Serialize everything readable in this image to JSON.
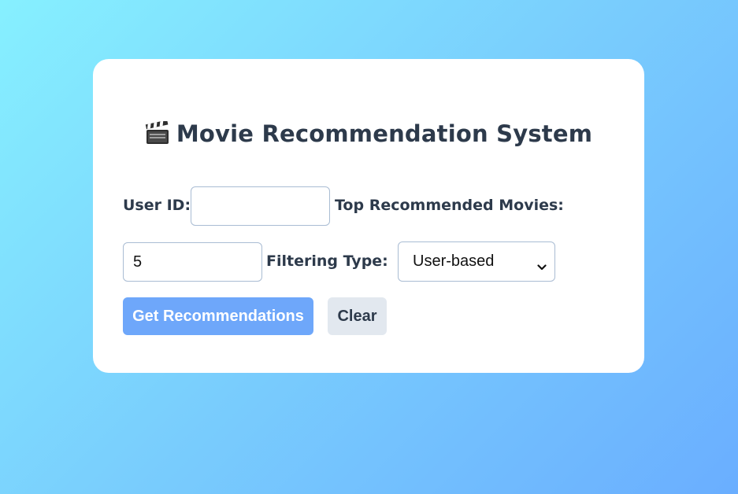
{
  "app": {
    "title": "Movie Recommendation System",
    "title_icon": "clapper-board-icon"
  },
  "form": {
    "user_id": {
      "label": "User ID:",
      "value": ""
    },
    "top_n": {
      "label": "Top Recommended Movies:",
      "value": "5"
    },
    "filtering_type": {
      "label": "Filtering Type:",
      "selected": "User-based"
    }
  },
  "actions": {
    "get_recommendations_label": "Get Recommendations",
    "clear_label": "Clear"
  },
  "colors": {
    "primary_button": "#6ea7fa",
    "secondary_button": "#e2e8ef",
    "text": "#2d3a4b"
  }
}
